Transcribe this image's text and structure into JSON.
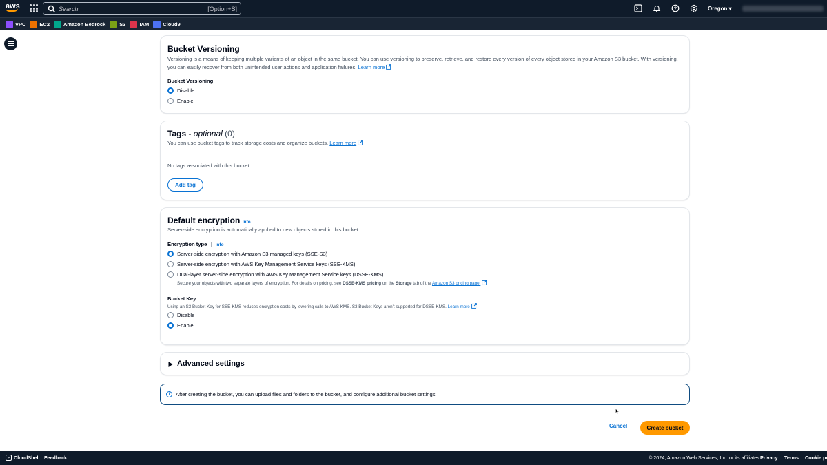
{
  "topnav": {
    "search_placeholder": "Search",
    "search_shortcut": "[Option+S]",
    "region": "Oregon ▾"
  },
  "favorites": [
    {
      "label": "VPC",
      "color": "#8c4fff"
    },
    {
      "label": "EC2",
      "color": "#ed7100"
    },
    {
      "label": "Amazon Bedrock",
      "color": "#01a88d"
    },
    {
      "label": "S3",
      "color": "#7aa116"
    },
    {
      "label": "IAM",
      "color": "#dd344c"
    },
    {
      "label": "Cloud9",
      "color": "#4d72f3"
    }
  ],
  "versioning": {
    "title": "Bucket Versioning",
    "desc_line1": "Versioning is a means of keeping multiple variants of an object in the same bucket. You can use versioning to preserve, retrieve, and restore every version of every object stored in your Amazon S3 bucket. With versioning,",
    "desc_line2": "you can easily recover from both unintended user actions and application failures.",
    "learn_more": "Learn more",
    "field_label": "Bucket Versioning",
    "opt_disable": "Disable",
    "opt_enable": "Enable"
  },
  "tags": {
    "title": "Tags - ",
    "title_optional": "optional",
    "count": " (0)",
    "desc": "You can use bucket tags to track storage costs and organize buckets.",
    "learn_more": "Learn more",
    "empty": "No tags associated with this bucket.",
    "add_tag": "Add tag"
  },
  "encryption": {
    "title": "Default encryption",
    "info": "Info",
    "desc": "Server-side encryption is automatically applied to new objects stored in this bucket.",
    "type_label": "Encryption type",
    "type_info": "Info",
    "opt_sse_s3": "Server-side encryption with Amazon S3 managed keys (SSE-S3)",
    "opt_sse_kms": "Server-side encryption with AWS Key Management Service keys (SSE-KMS)",
    "opt_dsse_kms": "Dual-layer server-side encryption with AWS Key Management Service keys (DSSE-KMS)",
    "dsse_sub_1": "Secure your objects with two separate layers of encryption. For details on pricing, see ",
    "dsse_sub_bold": "DSSE-KMS pricing",
    "dsse_sub_2": " on the ",
    "dsse_sub_storage": "Storage",
    "dsse_sub_3": " tab of the ",
    "dsse_sub_link": "Amazon S3 pricing page.",
    "bucket_key_label": "Bucket Key",
    "bucket_key_desc": "Using an S3 Bucket Key for SSE-KMS reduces encryption costs by lowering calls to AWS KMS. S3 Bucket Keys aren't supported for DSSE-KMS.",
    "bucket_key_learn": "Learn more",
    "bk_disable": "Disable",
    "bk_enable": "Enable"
  },
  "advanced": {
    "label": "Advanced settings"
  },
  "alert": {
    "text": "After creating the bucket, you can upload files and folders to the bucket, and configure additional bucket settings."
  },
  "actions": {
    "cancel": "Cancel",
    "create": "Create bucket"
  },
  "footer": {
    "cloudshell": "CloudShell",
    "feedback": "Feedback",
    "copyright": "© 2024, Amazon Web Services, Inc. or its affiliates.",
    "privacy": "Privacy",
    "terms": "Terms",
    "cookie": "Cookie pre"
  }
}
